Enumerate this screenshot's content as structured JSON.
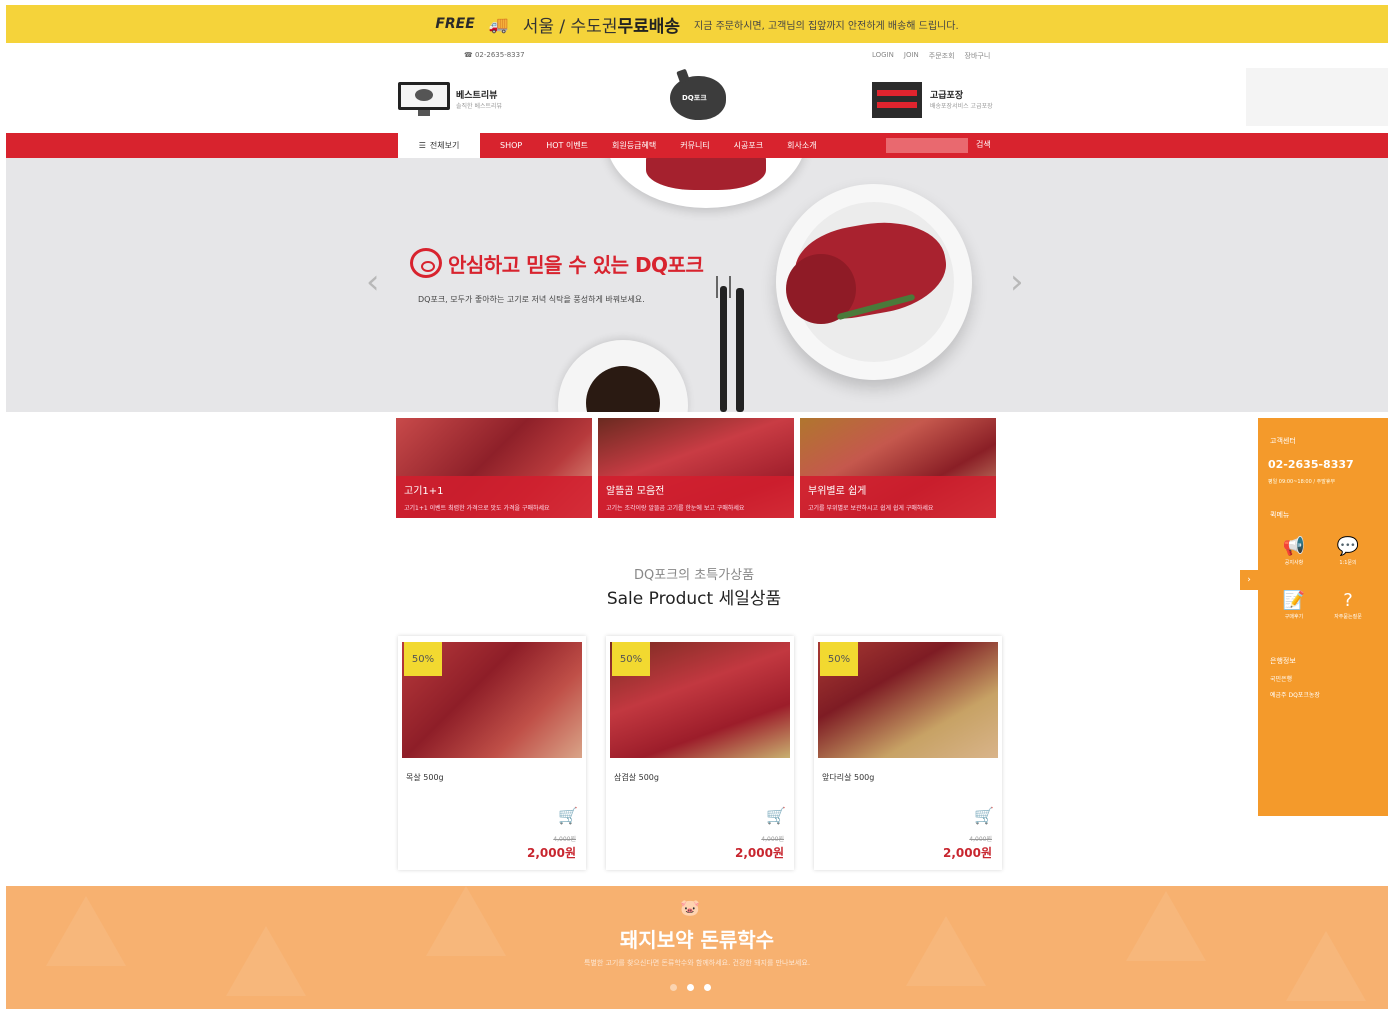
{
  "top_banner": {
    "free": "FREE",
    "area_prefix": "서울 / 수도권",
    "area_bold": "무료배송",
    "desc": "지금 주문하시면, 고객님의 집앞까지 안전하게 배송해 드립니다."
  },
  "util": {
    "phone": "☎ 02-2635-8337",
    "links": [
      "LOGIN",
      "JOIN",
      "주문조회",
      "장바구니"
    ]
  },
  "header": {
    "best_review_title": "베스트리뷰",
    "best_review_sub": "솔직한 베스트리뷰",
    "brand": "DQ포크",
    "premium_title": "고급포장",
    "premium_sub": "배송포장서비스 고급포장"
  },
  "nav": {
    "all_label": "전체보기",
    "items": [
      "SHOP",
      "HOT 이벤트",
      "회원등급혜택",
      "커뮤니티",
      "시공포크",
      "회사소개"
    ],
    "search_button": "검색"
  },
  "hero": {
    "title": "안심하고 믿을 수 있는 DQ포크",
    "subtitle": "DQ포크, 모두가 좋아하는 고기로 저녁 식탁을 풍성하게 바꿔보세요.",
    "prev": "‹",
    "next": "›"
  },
  "categories": [
    {
      "title": "고기1+1",
      "desc": "고기1+1 이벤트 최렴한 가격으로 맛도 가격을 구매하세요"
    },
    {
      "title": "알뜰곰 모음전",
      "desc": "고기는 조각이랑 알뜰곰 고기를 한눈에 보고 구매하세요"
    },
    {
      "title": "부위별로 쉽게",
      "desc": "고기를 부위별로 보관하시고 쉽게 쉽게 구매하세요"
    }
  ],
  "sale": {
    "subtitle": "DQ포크의 초특가상품",
    "title": "Sale Product 세일상품"
  },
  "products": [
    {
      "badge": "50%",
      "name": "목살 500g",
      "old_price": "4,000원",
      "price": "2,000원"
    },
    {
      "badge": "50%",
      "name": "삼겹살 500g",
      "old_price": "4,000원",
      "price": "2,000원"
    },
    {
      "badge": "50%",
      "name": "앞다리살 500g",
      "old_price": "4,000원",
      "price": "2,000원"
    }
  ],
  "sidebar": {
    "tab": "›",
    "cs_label": "고객센터",
    "phone": "02-2635-8337",
    "hours": "평일 09:00~18:00 / 주말휴무",
    "quick_label": "퀵메뉴",
    "icons": [
      {
        "icon": "megaphone-icon",
        "glyph": "📢",
        "label": "공지사항"
      },
      {
        "icon": "chat-icon",
        "glyph": "💬",
        "label": "1:1문의"
      },
      {
        "icon": "review-icon",
        "glyph": "📝",
        "label": "구매후기"
      },
      {
        "icon": "question-icon",
        "glyph": "?",
        "label": "자주묻는질문"
      }
    ],
    "bank_label": "은행정보",
    "bank_name": "국민은행",
    "bank_account": "예금주 DQ포크농장"
  },
  "bottom_banner": {
    "title": "돼지보약 돈류학수",
    "subtitle": "특별한 고기를 찾으신다면 돈류학수와 함께하세요. 건강한 돼지를 만나보세요."
  },
  "colors": {
    "accent_red": "#d8232e",
    "banner_yellow": "#f5d33a",
    "sidebar_orange": "#f49a2b",
    "bottom_orange": "#f7b170"
  }
}
